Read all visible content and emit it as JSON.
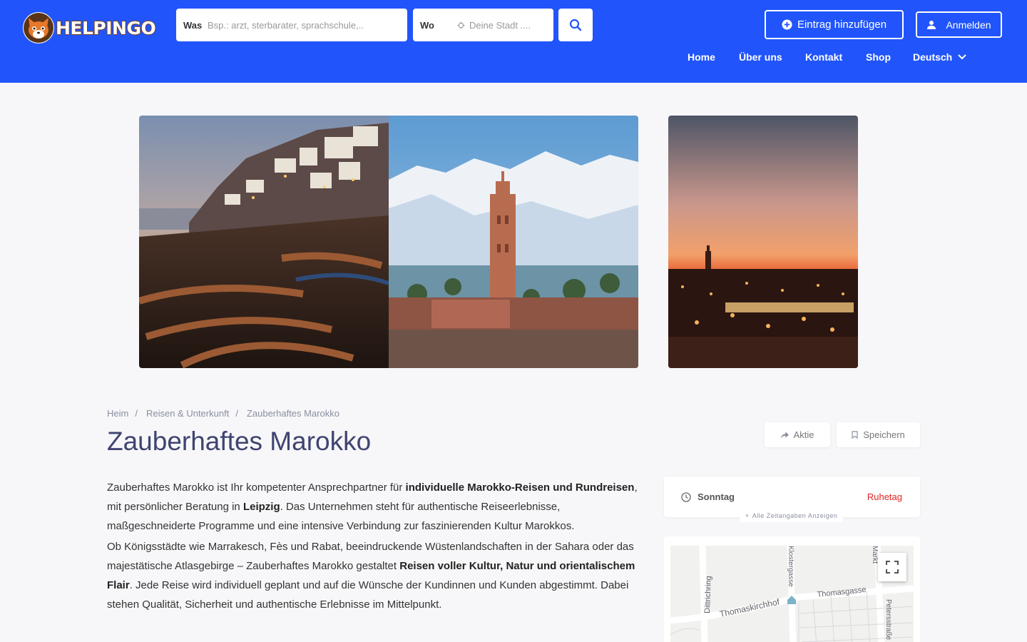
{
  "header": {
    "brand": "HELPINGO",
    "search_what": {
      "label": "Was",
      "placeholder": "Bsp.: arzt, sterbarater, sprachschule,.."
    },
    "search_where": {
      "label": "Wo",
      "placeholder": "Deine Stadt ...."
    },
    "add_entry_label": "Eintrag hinzufügen",
    "login_label": "Anmelden",
    "nav": [
      {
        "label": "Home"
      },
      {
        "label": "Über uns"
      },
      {
        "label": "Kontakt"
      },
      {
        "label": "Shop"
      },
      {
        "label": "Deutsch"
      }
    ]
  },
  "breadcrumb": [
    "Heim",
    "Reisen & Unterkunft",
    "Zauberhaftes Marokko"
  ],
  "title": "Zauberhaftes Marokko",
  "actions": {
    "share": "Aktie",
    "save": "Speichern"
  },
  "description": {
    "p1": {
      "t1": "Zauberhaftes Marokko ist Ihr kompetenter Ansprechpartner für ",
      "b1": "individuelle Marokko-Reisen und Rundreisen",
      "t2": ", mit persönlicher Beratung in ",
      "b2": "Leipzig",
      "t3": ". Das Unternehmen steht für authentische Reiseerlebnisse, maßgeschneiderte Programme und eine intensive Verbindung zur faszinierenden Kultur Marokkos."
    },
    "p2": {
      "t1": "Ob Königsstädte wie Marrakesch, Fès und Rabat, beeindruckende Wüstenlandschaften in der Sahara oder das majestätische Atlasgebirge – Zauberhaftes Marokko gestaltet ",
      "b1": "Reisen voller Kultur, Natur und orientalischem Flair",
      "t2": ". Jede Reise wird individuell geplant und auf die Wünsche der Kundinnen und Kunden abgestimmt. Dabei stehen Qualität, Sicherheit und authentische Erlebnisse im Mittelpunkt."
    }
  },
  "hours": {
    "day": "Sonntag",
    "status": "Ruhetag",
    "show_all": "Alle Zeitangaben Anzeigen"
  },
  "map": {
    "streets": [
      "Dittrichring",
      "Thomaskirchhof",
      "Thomasgasse",
      "Klostergasse",
      "Petersstraße",
      "Markt"
    ]
  },
  "colors": {
    "brand": "#2155fb",
    "closed": "#e32323",
    "title": "#3f4470"
  }
}
